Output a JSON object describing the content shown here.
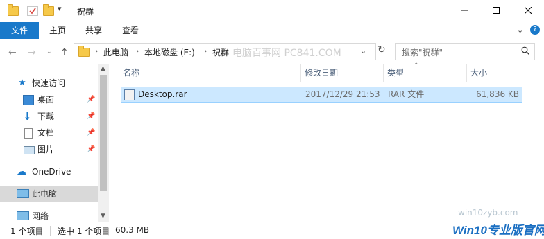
{
  "window": {
    "title": "祝群",
    "quick_access_toolbar": [
      "folder-icon",
      "properties-icon",
      "new-folder-icon",
      "customize-dropdown-icon"
    ]
  },
  "ribbon": {
    "tabs": [
      {
        "label": "文件",
        "active": true
      },
      {
        "label": "主页"
      },
      {
        "label": "共享"
      },
      {
        "label": "查看"
      }
    ],
    "colors": {
      "file_tab": "#1979ca"
    }
  },
  "address_bar": {
    "segments": [
      "此电脑",
      "本地磁盘 (E:)",
      "祝群"
    ],
    "watermark": "电脑百事网 PC841.COM"
  },
  "search": {
    "placeholder": "搜索\"祝群\""
  },
  "nav_pane": {
    "quick_access_label": "快速访问",
    "items": [
      {
        "label": "桌面",
        "icon": "desktop-icon",
        "pinned": true
      },
      {
        "label": "下载",
        "icon": "download-icon",
        "pinned": true
      },
      {
        "label": "文档",
        "icon": "document-icon",
        "pinned": true
      },
      {
        "label": "图片",
        "icon": "picture-icon",
        "pinned": true
      }
    ],
    "onedrive": "OneDrive",
    "this_pc": "此电脑",
    "network": "网络"
  },
  "columns": {
    "name": "名称",
    "modified": "修改日期",
    "type": "类型",
    "size": "大小"
  },
  "files": [
    {
      "name": "Desktop.rar",
      "modified": "2017/12/29 21:53",
      "type": "RAR 文件",
      "size": "61,836 KB"
    }
  ],
  "status_bar": {
    "item_count": "1 个项目",
    "selected": "选中 1 个项目",
    "selected_size": "60.3 MB"
  },
  "watermarks": {
    "site": "win10zyb.com",
    "logo": "Win10专业版官网"
  }
}
